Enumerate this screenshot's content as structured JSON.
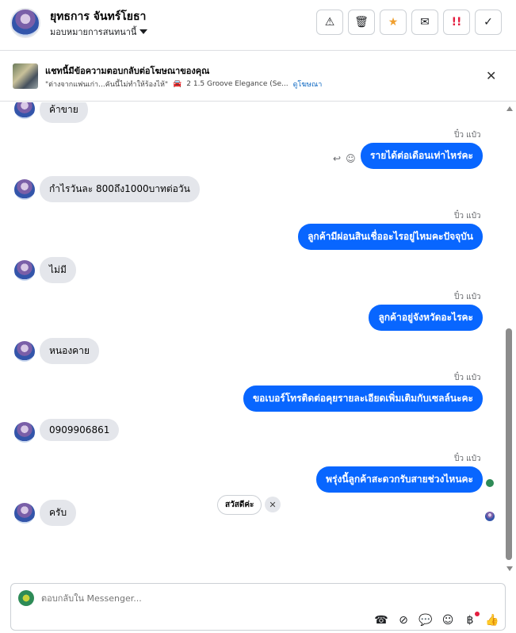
{
  "header": {
    "name": "ยุทธการ จันทร์โยธา",
    "assign_label": "มอบหมายการสนทนานี้",
    "toolbar": [
      {
        "icon": "warning-icon",
        "glyph": "⚠"
      },
      {
        "icon": "trash-icon",
        "glyph": "🗑"
      },
      {
        "icon": "star-icon",
        "glyph": "★"
      },
      {
        "icon": "envelope-open-icon",
        "glyph": "✉"
      },
      {
        "icon": "priority-icon",
        "glyph": "!!"
      },
      {
        "icon": "check-icon",
        "glyph": "✓"
      }
    ]
  },
  "ad_banner": {
    "title": "แชทนี้มีข้อความตอบกลับต่อโฆษณาของคุณ",
    "quote": "\"ต่างจากแฟนเก่า...คันนี้ไม่ทำให้ร้องไห้\"",
    "product": "2 1.5 Groove Elegance (Se...",
    "link": "ดูโฆษณา"
  },
  "messages": [
    {
      "dir": "in",
      "text": "ค้าขาย"
    },
    {
      "dir": "out",
      "sender": "ปิ๋ว แป๋ว",
      "text": "รายได้ต่อเดือนเท่าไหร่คะ"
    },
    {
      "dir": "in",
      "text": "กำไรวันละ 800ถึง1000บาทต่อวัน"
    },
    {
      "dir": "out",
      "sender": "ปิ๋ว แป๋ว",
      "text": "ลูกค้ามีผ่อนสินเชื่ออะไรอยู่ไหมคะปัจจุบัน"
    },
    {
      "dir": "in",
      "text": "ไม่มี"
    },
    {
      "dir": "out",
      "sender": "ปิ๋ว แป๋ว",
      "text": "ลูกค้าอยู่จังหวัดอะไรคะ"
    },
    {
      "dir": "in",
      "text": "หนองคาย"
    },
    {
      "dir": "out",
      "sender": "ปิ๋ว แป๋ว",
      "text": "ขอเบอร์โทรติดต่อคุยรายละเอียดเพิ่มเติมกับเซลล์นะคะ"
    },
    {
      "dir": "in",
      "text": "0909906861"
    },
    {
      "dir": "out",
      "sender": "ปิ๋ว แป๋ว",
      "text": "พรุ่งนี้ลูกค้าสะดวกรับสายช่วงไหนคะ"
    },
    {
      "dir": "in",
      "text": "ครับ"
    }
  ],
  "suggestion": "สวัสดีค่ะ",
  "composer": {
    "placeholder": "ตอบกลับใน Messenger...",
    "tools": [
      "add-contact-icon",
      "attach-icon",
      "chat-icon",
      "emoji-icon",
      "currency-icon",
      "thumbs-up-icon"
    ]
  },
  "colors": {
    "outgoing": "#0866ff",
    "incoming": "#e4e6eb",
    "accent_star": "#f0a030",
    "priority": "#e41e3f"
  }
}
